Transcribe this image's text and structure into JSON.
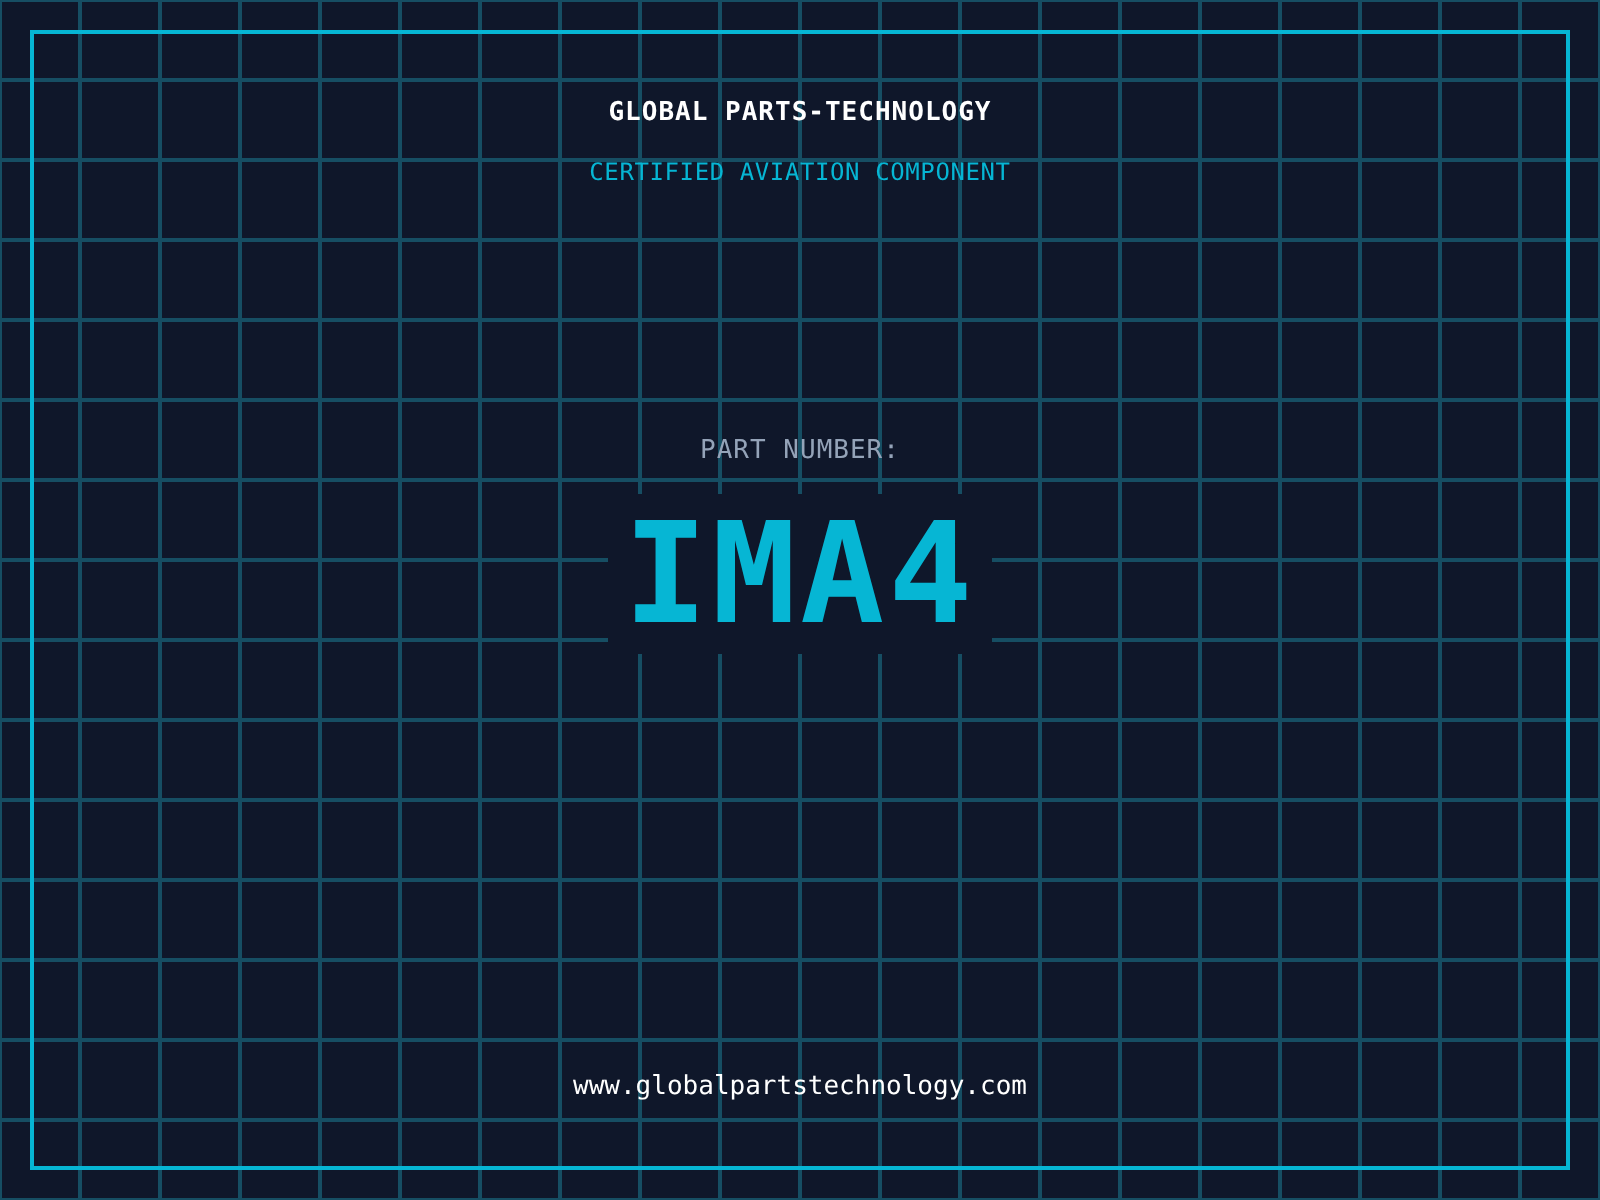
{
  "header": {
    "title": "GLOBAL PARTS-TECHNOLOGY",
    "subtitle": "CERTIFIED AVIATION COMPONENT"
  },
  "part": {
    "label": "PART NUMBER:",
    "number": "IMA4"
  },
  "footer": {
    "url": "www.globalpartstechnology.com"
  }
}
